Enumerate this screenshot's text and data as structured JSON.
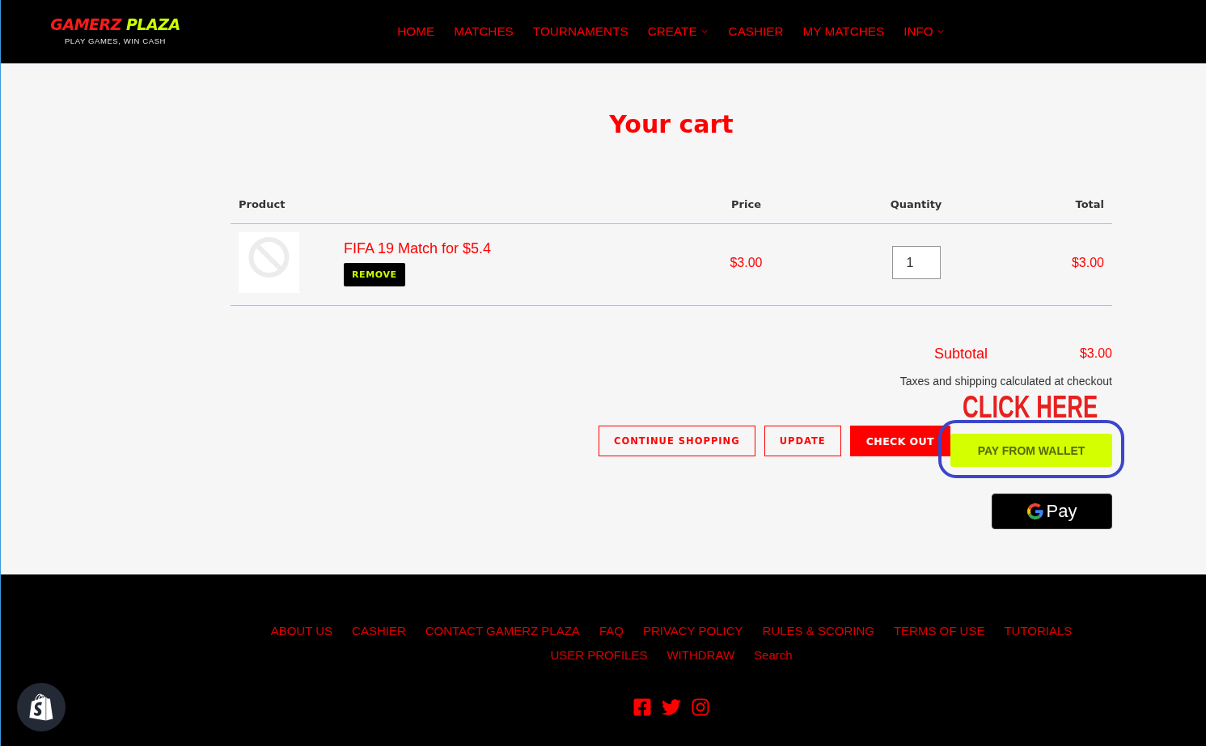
{
  "header": {
    "logo": {
      "words": [
        {
          "text": "GAMERZ",
          "color": "#ff1a1a"
        },
        {
          "text": "PLAZA",
          "color": "#ccff00"
        }
      ],
      "tagline": "PLAY GAMES, WIN CASH"
    },
    "nav": [
      {
        "label": "HOME",
        "dropdown": false
      },
      {
        "label": "MATCHES",
        "dropdown": false
      },
      {
        "label": "TOURNAMENTS",
        "dropdown": false
      },
      {
        "label": "CREATE",
        "dropdown": true
      },
      {
        "label": "CASHIER",
        "dropdown": false
      },
      {
        "label": "MY MATCHES",
        "dropdown": false
      },
      {
        "label": "INFO",
        "dropdown": true
      }
    ]
  },
  "cart": {
    "title": "Your cart",
    "columns": [
      "Product",
      "Price",
      "Quantity",
      "Total"
    ],
    "items": [
      {
        "name": "FIFA 19 Match for $5.4",
        "remove": "REMOVE",
        "price": "$3.00",
        "quantity": "1",
        "total": "$3.00"
      }
    ],
    "subtotal": {
      "label": "Subtotal",
      "value": "$3.00"
    },
    "note": "Taxes and shipping calculated at checkout",
    "annotation": "CLICK HERE",
    "buttons": [
      {
        "label": "CONTINUE SHOPPING",
        "kind": "outline",
        "highlighted": false
      },
      {
        "label": "UPDATE",
        "kind": "outline",
        "highlighted": false
      },
      {
        "label": "CHECK OUT",
        "kind": "primary",
        "highlighted": false
      },
      {
        "label": "PAY FROM WALLET",
        "kind": "wallet",
        "highlighted": true
      }
    ],
    "gpay": {
      "label": "Pay"
    }
  },
  "footer": {
    "link_rows": [
      {
        "links": [
          "ABOUT US",
          "CASHIER",
          "CONTACT GAMERZ PLAZA",
          "FAQ",
          "PRIVACY POLICY",
          "RULES & SCORING",
          "TERMS OF USE",
          "TUTORIALS"
        ]
      },
      {
        "links": [
          "USER PROFILES",
          "WITHDRAW",
          "Search"
        ]
      }
    ]
  }
}
